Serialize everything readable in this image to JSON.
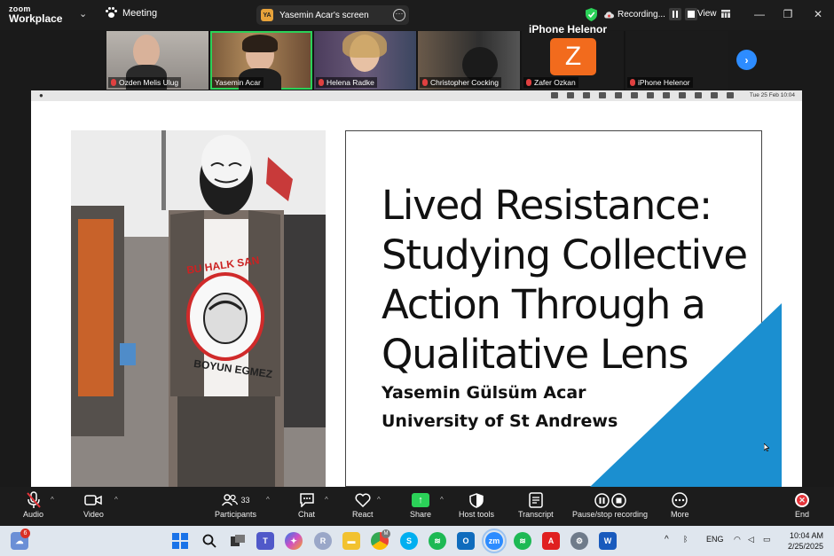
{
  "app": {
    "logo_line1": "zoom",
    "logo_line2": "Workplace",
    "meeting_label": "Meeting",
    "screen_share_initials": "YA",
    "screen_share_label": "Yasemin Acar's screen",
    "recording_label": "Recording...",
    "view_label": "View",
    "accent_color": "#2d8cff",
    "active_speaker_color": "#2bd158"
  },
  "participants": [
    {
      "name": "Ozden Melis Ulug",
      "muted": true
    },
    {
      "name": "Yasemin Acar",
      "muted": false,
      "active": true
    },
    {
      "name": "Helena Radke",
      "muted": true
    },
    {
      "name": "Christopher Cocking",
      "muted": true
    },
    {
      "name": "Zafer Ozkan",
      "muted": true,
      "avatar_letter": "Z"
    },
    {
      "name": "iPhone Helenor",
      "muted": true,
      "big_name": "iPhone Helenor"
    }
  ],
  "shared_screen": {
    "mac_date": "Tue 25 Feb  10:04",
    "slide": {
      "title": "Lived Resistance: Studying Collective Action Through a Qualitative Lens",
      "author": "Yasemin Gülsüm Acar",
      "institution": "University of St Andrews",
      "accent_color": "#1b8fd0"
    },
    "photo_shirt_text_top": "BU HALK SAN",
    "photo_shirt_text_bottom": "BOYUN EGMEZ"
  },
  "toolbar": {
    "audio": "Audio",
    "video": "Video",
    "participants": "Participants",
    "participants_count": "33",
    "chat": "Chat",
    "react": "React",
    "share": "Share",
    "host_tools": "Host tools",
    "transcript": "Transcript",
    "pause_stop_recording": "Pause/stop recording",
    "more": "More",
    "end": "End"
  },
  "taskbar": {
    "notification_count": "6",
    "chrome_badge": "M",
    "language": "ENG",
    "time": "10:04 AM",
    "date": "2/25/2025"
  }
}
